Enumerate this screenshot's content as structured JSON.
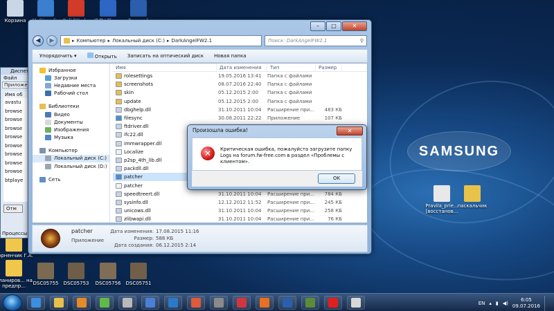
{
  "desktop": {
    "brand_logo": "SAMSUNG",
    "top_icons": [
      {
        "label": "Корзина",
        "icon": "recycle-bin-icon",
        "color": "#c9d6e6"
      },
      {
        "label": "Multimedia",
        "icon": "multimedia-icon",
        "color": "#3b7fd0"
      },
      {
        "label": "SolidWorks",
        "icon": "solidworks-icon",
        "color": "#d23a2a"
      },
      {
        "label": "IP-TV Player",
        "icon": "iptv-icon",
        "color": "#2d66c4"
      },
      {
        "label": "Розарий",
        "icon": "word-doc-icon",
        "color": "#2b5fad"
      }
    ],
    "left_icons": [
      {
        "label": "Корненчик Г.А.",
        "icon": "folder-icon",
        "color": "#f0c64b"
      },
      {
        "label": "Планиров... на предпр...",
        "icon": "folder-icon",
        "color": "#f0c64b"
      }
    ],
    "bottom_icons": [
      {
        "label": "DSC05755",
        "icon": "photo-icon",
        "color": "#7a6a52"
      },
      {
        "label": "DSC05753",
        "icon": "photo-icon",
        "color": "#6e5e47"
      },
      {
        "label": "DSC05756",
        "icon": "photo-icon",
        "color": "#7f6d55"
      },
      {
        "label": "DSC05751",
        "icon": "photo-icon",
        "color": "#715f49"
      }
    ],
    "right_icons": [
      {
        "label": "Pravila_prie... [восстанов...",
        "icon": "word-doc-icon",
        "color": "#e8e8e8"
      },
      {
        "label": "паскальчик",
        "icon": "file-icon",
        "color": "#e9c24a"
      }
    ]
  },
  "background_window": {
    "title": "Диспетч",
    "menu": "Файл",
    "tab": "Приложен",
    "column_header": "Имя об",
    "rows": [
      "avastu",
      "browse",
      "browse",
      "browse",
      "browse",
      "browse",
      "browse",
      "browse",
      "browse",
      "btplaye"
    ],
    "button": "Отм",
    "status": "Процессы"
  },
  "explorer": {
    "address_parts": [
      "Компьютер",
      "Локальный диск (C:)",
      "DarkAngelFW2.1"
    ],
    "search_placeholder": "Поиск: DarkAngelFW2.1",
    "toolbar": {
      "organize": "Упорядочить ▾",
      "open": "Открыть",
      "burn": "Записать на оптический диск",
      "new_folder": "Новая папка"
    },
    "nav": {
      "favorites": "Избранное",
      "favorites_items": [
        "Загрузки",
        "Недавние места",
        "Рабочий стол"
      ],
      "libraries": "Библиотеки",
      "library_items": [
        "Видео",
        "Документы",
        "Изображения",
        "Музыка"
      ],
      "computer": "Компьютер",
      "computer_items": [
        "Локальный диск (C:)",
        "Локальный диск (D:)"
      ],
      "network": "Сеть"
    },
    "columns": {
      "name": "Имя",
      "date": "Дата изменения",
      "type": "Тип",
      "size": "Размер"
    },
    "files": [
      {
        "name": "rolesettings",
        "date": "19.05.2016 13:41",
        "type": "Папка с файлами",
        "size": "",
        "kind": "folder"
      },
      {
        "name": "screenshots",
        "date": "08.07.2016 22:40",
        "type": "Папка с файлами",
        "size": "",
        "kind": "folder"
      },
      {
        "name": "skin",
        "date": "05.12.2015 2:00",
        "type": "Папка с файлами",
        "size": "",
        "kind": "folder"
      },
      {
        "name": "update",
        "date": "05.12.2015 2:00",
        "type": "Папка с файлами",
        "size": "",
        "kind": "folder"
      },
      {
        "name": "dbghelp.dll",
        "date": "31.10.2011 10:04",
        "type": "Расширение при...",
        "size": "483 КБ",
        "kind": "dll"
      },
      {
        "name": "filesync",
        "date": "30.08.2011 22:22",
        "type": "Приложение",
        "size": "107 КБ",
        "kind": "app"
      },
      {
        "name": "ftdriver.dll",
        "date": "",
        "type": "",
        "size": "",
        "kind": "dll"
      },
      {
        "name": "ifc22.dll",
        "date": "",
        "type": "",
        "size": "",
        "kind": "dll"
      },
      {
        "name": "immwrapper.dll",
        "date": "",
        "type": "",
        "size": "",
        "kind": "dll"
      },
      {
        "name": "Localize",
        "date": "",
        "type": "",
        "size": "",
        "kind": "file"
      },
      {
        "name": "p2sp_4th_lib.dll",
        "date": "",
        "type": "",
        "size": "",
        "kind": "dll"
      },
      {
        "name": "packdll.dll",
        "date": "",
        "type": "",
        "size": "",
        "kind": "dll"
      },
      {
        "name": "patcher",
        "date": "",
        "type": "",
        "size": "",
        "kind": "app"
      },
      {
        "name": "patcher",
        "date": "",
        "type": "",
        "size": "",
        "kind": "file"
      },
      {
        "name": "speedtreert.dll",
        "date": "31.10.2011 10:04",
        "type": "Расширение при...",
        "size": "784 КБ",
        "kind": "dll"
      },
      {
        "name": "sysinfo.dll",
        "date": "12.12.2012 11:52",
        "type": "Расширение при...",
        "size": "245 КБ",
        "kind": "dll"
      },
      {
        "name": "unicows.dll",
        "date": "31.10.2011 10:04",
        "type": "Расширение при...",
        "size": "258 КБ",
        "kind": "dll"
      },
      {
        "name": "zlibwapi.dll",
        "date": "31.10.2011 10:04",
        "type": "Расширение при...",
        "size": "76 КБ",
        "kind": "dll"
      }
    ],
    "selected_index": 12,
    "details": {
      "name": "patcher",
      "type": "Приложение",
      "modified_label": "Дата изменения:",
      "modified_value": "17.08.2015 11:16",
      "size_label": "Размер:",
      "size_value": "588 КБ",
      "created_label": "Дата создания:",
      "created_value": "06.12.2015 2:14"
    }
  },
  "dialog": {
    "title": "Произошла ошибка!",
    "close": "✕",
    "message": "Критическая ошибка, пожалуйста загрузите папку Logs на forum.fw-free.com в раздел «Проблемы с клиентом».",
    "ok": "OK"
  },
  "taskbar": {
    "apps": [
      {
        "icon": "ie-icon",
        "color": "#3c8fe0"
      },
      {
        "icon": "explorer-icon",
        "color": "#e7c04d"
      },
      {
        "icon": "media-player-icon",
        "color": "#e58a28"
      },
      {
        "icon": "pinwheel-icon",
        "color": "#62b848"
      },
      {
        "icon": "printer-icon",
        "color": "#b9b9b9"
      },
      {
        "icon": "chrome-icon",
        "color": "#4b7fd6"
      },
      {
        "icon": "k-app-icon",
        "color": "#2a7ac9"
      },
      {
        "icon": "shapes-icon",
        "color": "#e05a3c"
      },
      {
        "icon": "m-app-icon",
        "color": "#8a8a8a"
      },
      {
        "icon": "lips-icon",
        "color": "#d2363e"
      },
      {
        "icon": "firefox-icon",
        "color": "#e8701e"
      },
      {
        "icon": "word-icon",
        "color": "#2b5fad"
      },
      {
        "icon": "game-icon",
        "color": "#5b8c3a"
      },
      {
        "icon": "yandex-icon",
        "color": "#e0201c"
      },
      {
        "icon": "doc-app-icon",
        "color": "#d8d8d8"
      }
    ],
    "language": "EN",
    "time": "6:05",
    "date": "09.07.2016"
  }
}
